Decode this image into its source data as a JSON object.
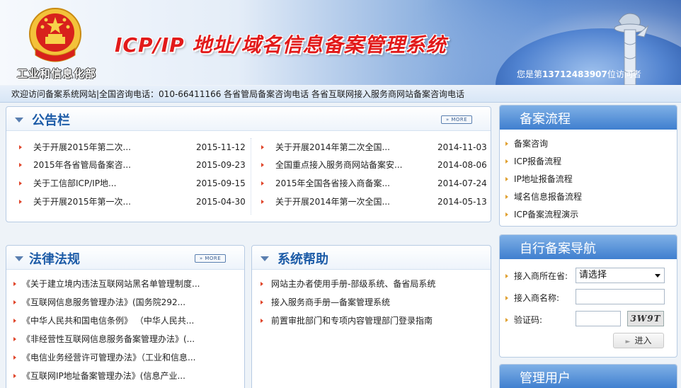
{
  "header": {
    "ministry": "工业和信息化部",
    "title": "ICP/IP 地址/域名信息备案管理系统",
    "visitor_prefix": "您是第",
    "visitor_count": "13712483907",
    "visitor_suffix": "位访问者"
  },
  "notice": "欢迎访问备案系统网站|全国咨询电话：010-66411166 各省管局备案咨询电话 各省互联网接入服务商网站备案咨询电话",
  "bulletin": {
    "title": "公告栏",
    "more": "» MORE",
    "left": [
      {
        "text": "关于开展2015年第二次...",
        "date": "2015-11-12"
      },
      {
        "text": "2015年各省管局备案咨...",
        "date": "2015-09-23"
      },
      {
        "text": "关于工信部ICP/IP地...",
        "date": "2015-09-15"
      },
      {
        "text": "关于开展2015年第一次...",
        "date": "2015-04-30"
      }
    ],
    "right": [
      {
        "text": "关于开展2014年第二次全国...",
        "date": "2014-11-03"
      },
      {
        "text": "全国重点接入服务商网站备案安...",
        "date": "2014-08-06"
      },
      {
        "text": "2015年全国各省接入商备案...",
        "date": "2014-07-24"
      },
      {
        "text": "关于开展2014年第一次全国...",
        "date": "2014-05-13"
      }
    ]
  },
  "laws": {
    "title": "法律法规",
    "more": "» MORE",
    "items": [
      "《关于建立境内违法互联网站黑名单管理制度...",
      "《互联网信息服务管理办法》(国务院292...",
      "《中华人民共和国电信条例》 （中华人民共...",
      "《非经营性互联网信息服务备案管理办法》(...",
      "《电信业务经营许可管理办法》（工业和信息...",
      "《互联网IP地址备案管理办法》(信息产业..."
    ]
  },
  "help": {
    "title": "系统帮助",
    "items": [
      "网站主办者使用手册-部级系统、备省局系统",
      "接入服务商手册—备案管理系统",
      "前置审批部门和专项内容管理部门登录指南"
    ]
  },
  "process": {
    "title": "备案流程",
    "items": [
      "备案咨询",
      "ICP报备流程",
      "IP地址报备流程",
      "域名信息报备流程",
      "ICP备案流程演示"
    ]
  },
  "nav": {
    "title": "自行备案导航",
    "province_label": "接入商所在省:",
    "province_value": "请选择",
    "name_label": "接入商名称:",
    "code_label": "验证码:",
    "captcha": "3W9T",
    "enter": "进入"
  },
  "manage": {
    "title": "管理用户"
  }
}
